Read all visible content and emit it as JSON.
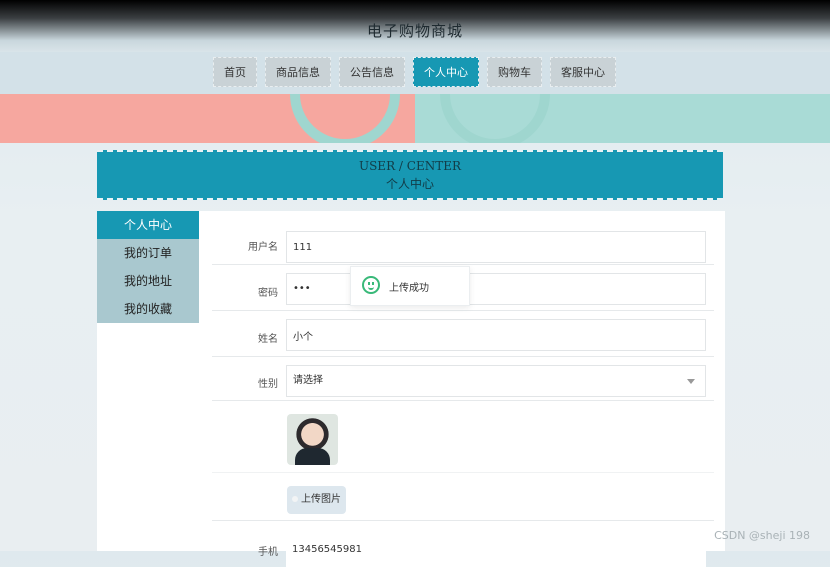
{
  "site": {
    "title": "电子购物商城"
  },
  "nav": {
    "items": [
      {
        "label": "首页",
        "active": false
      },
      {
        "label": "商品信息",
        "active": false
      },
      {
        "label": "公告信息",
        "active": false
      },
      {
        "label": "个人中心",
        "active": true
      },
      {
        "label": "购物车",
        "active": false
      },
      {
        "label": "客服中心",
        "active": false
      }
    ]
  },
  "section": {
    "title_en": "USER / CENTER",
    "title_cn": "个人中心"
  },
  "sidebar": {
    "items": [
      {
        "label": "个人中心",
        "active": true
      },
      {
        "label": "我的订单",
        "active": false
      },
      {
        "label": "我的地址",
        "active": false
      },
      {
        "label": "我的收藏",
        "active": false
      }
    ]
  },
  "form": {
    "username_label": "用户名",
    "username_value": "111",
    "password_label": "密码",
    "password_value": "•••",
    "name_label": "姓名",
    "name_value": "小个",
    "gender_label": "性别",
    "gender_placeholder": "请选择",
    "upload_label": "上传图片",
    "phone_label": "手机",
    "phone_value": "13456545981"
  },
  "toast": {
    "message": "上传成功"
  },
  "watermark": "CSDN @sheji 198"
}
